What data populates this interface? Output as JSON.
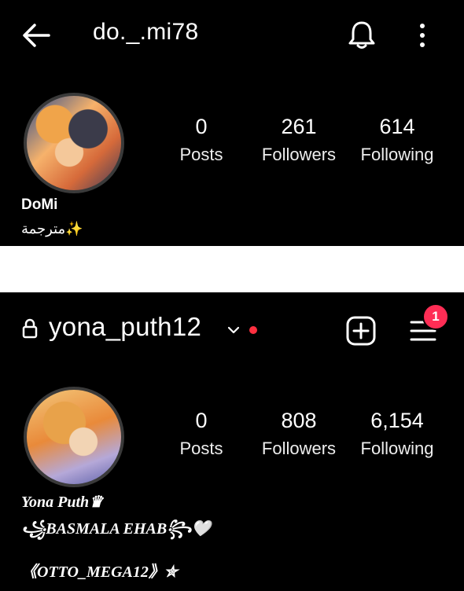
{
  "profile1": {
    "username": "do._.mi78",
    "icons": {
      "back": "arrow-left-icon",
      "bell": "bell-icon",
      "more": "more-vertical-icon"
    },
    "stats": [
      {
        "value": "0",
        "label": "Posts"
      },
      {
        "value": "261",
        "label": "Followers"
      },
      {
        "value": "614",
        "label": "Following"
      }
    ],
    "name": "DoMi",
    "bio": "مترجمة✨"
  },
  "profile2": {
    "username": "yona_puth12",
    "icons": {
      "lock": "lock-icon",
      "chevron": "chevron-down-icon",
      "add": "plus-square-icon",
      "menu": "hamburger-menu-icon"
    },
    "menu_badge": "1",
    "status_dot_color": "#ff3040",
    "stats": [
      {
        "value": "0",
        "label": "Posts"
      },
      {
        "value": "808",
        "label": "Followers"
      },
      {
        "value": "6,154",
        "label": "Following"
      }
    ],
    "name": "Yona Puth♛",
    "bio_line1": "꧁BASMALA EHAB꧂🤍",
    "bio_line2": "《OTTO_MEGA12》✮"
  }
}
